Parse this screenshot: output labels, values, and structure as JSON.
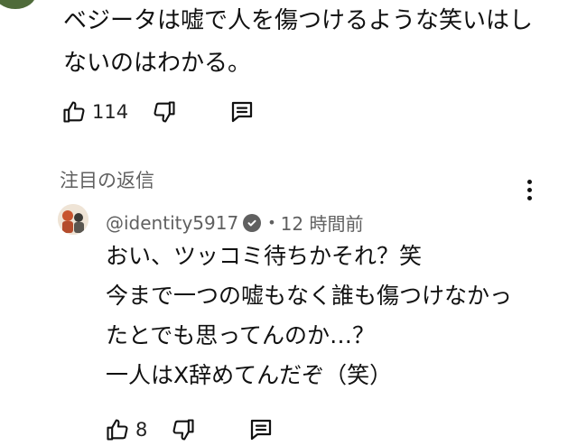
{
  "comment": {
    "lines": [
      "ベジータは嘘で人を傷つけるような笑いはし",
      "ないのはわかる。"
    ],
    "like_count": "114"
  },
  "pinned_reply": {
    "label": "注目の返信",
    "author": "@identity5917",
    "time": "12 時間前",
    "separator": "•",
    "lines": [
      "おい、ツッコミ待ちかそれ？笑",
      "今まで一つの嘘もなく誰も傷つけなかっ",
      "たとでも思ってんのか…？",
      "一人はX辞めてんだぞ（笑）"
    ],
    "like_count": "8"
  },
  "icons": {
    "like": "thumbs-up-icon",
    "dislike": "thumbs-down-icon",
    "reply": "comment-icon",
    "more": "more-vert-icon",
    "verified": "verified-check-icon"
  },
  "colors": {
    "text": "#0f0f0f",
    "secondary": "#606060",
    "background": "#ffffff"
  }
}
